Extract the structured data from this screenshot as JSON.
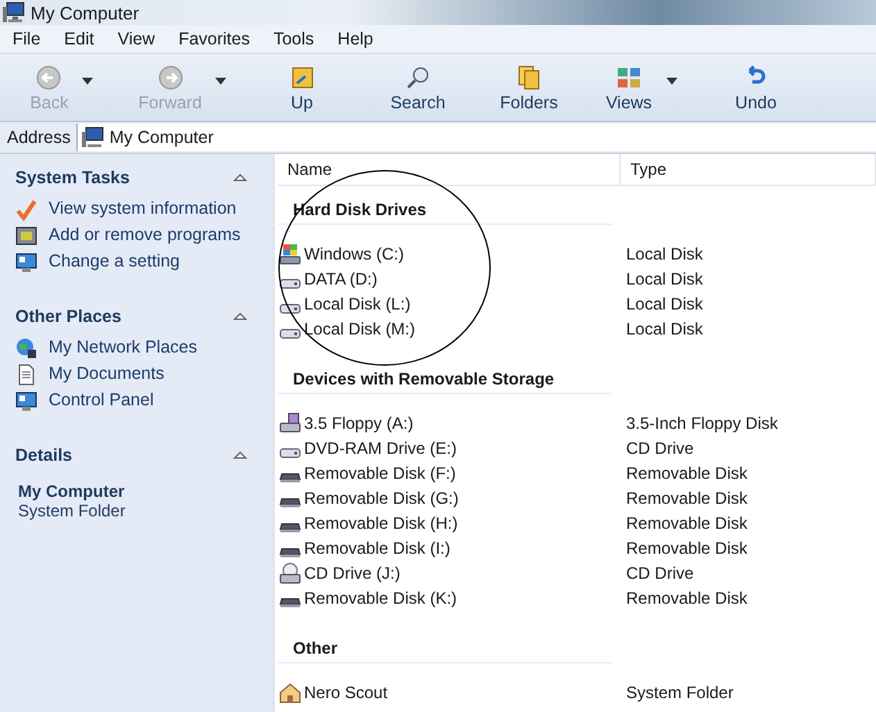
{
  "window": {
    "title": "My Computer"
  },
  "menu": [
    "File",
    "Edit",
    "View",
    "Favorites",
    "Tools",
    "Help"
  ],
  "toolbar": [
    {
      "kind": "back",
      "label": "Back",
      "disabled": true,
      "dropdown": true
    },
    {
      "kind": "forward",
      "label": "Forward",
      "disabled": true,
      "dropdown": true
    },
    {
      "kind": "up",
      "label": "Up",
      "disabled": false,
      "dropdown": false
    },
    {
      "kind": "search",
      "label": "Search",
      "disabled": false,
      "dropdown": false
    },
    {
      "kind": "folders",
      "label": "Folders",
      "disabled": false,
      "dropdown": false
    },
    {
      "kind": "views",
      "label": "Views",
      "disabled": false,
      "dropdown": true
    },
    {
      "kind": "undo",
      "label": "Undo",
      "disabled": false,
      "dropdown": false
    }
  ],
  "address": {
    "label": "Address",
    "value": "My Computer"
  },
  "sidebar": {
    "sections": [
      {
        "title": "System Tasks",
        "expanded": true,
        "items": [
          {
            "kind": "check",
            "label": "View system information"
          },
          {
            "kind": "programs",
            "label": "Add or remove programs"
          },
          {
            "kind": "setting",
            "label": "Change a setting"
          }
        ]
      },
      {
        "title": "Other Places",
        "expanded": true,
        "items": [
          {
            "kind": "network",
            "label": "My Network Places"
          },
          {
            "kind": "documents",
            "label": "My Documents"
          },
          {
            "kind": "setting",
            "label": "Control Panel"
          }
        ]
      }
    ],
    "details": {
      "title": "Details",
      "expanded": true,
      "name": "My Computer",
      "type": "System Folder"
    }
  },
  "columns": [
    "Name",
    "Type"
  ],
  "groups": [
    {
      "title": "Hard Disk Drives",
      "rows": [
        {
          "kind": "windows",
          "name": "Windows (C:)",
          "type": "Local Disk"
        },
        {
          "kind": "hdd",
          "name": "DATA (D:)",
          "type": "Local Disk"
        },
        {
          "kind": "hdd",
          "name": "Local Disk (L:)",
          "type": "Local Disk"
        },
        {
          "kind": "hdd",
          "name": "Local Disk (M:)",
          "type": "Local Disk"
        }
      ]
    },
    {
      "title": "Devices with Removable Storage",
      "rows": [
        {
          "kind": "floppy",
          "name": "3.5 Floppy (A:)",
          "type": "3.5-Inch Floppy Disk"
        },
        {
          "kind": "hdd",
          "name": "DVD-RAM Drive (E:)",
          "type": "CD Drive"
        },
        {
          "kind": "removable",
          "name": "Removable Disk (F:)",
          "type": "Removable Disk"
        },
        {
          "kind": "removable",
          "name": "Removable Disk (G:)",
          "type": "Removable Disk"
        },
        {
          "kind": "removable",
          "name": "Removable Disk (H:)",
          "type": "Removable Disk"
        },
        {
          "kind": "removable",
          "name": "Removable Disk (I:)",
          "type": "Removable Disk"
        },
        {
          "kind": "cd",
          "name": "CD Drive (J:)",
          "type": "CD Drive"
        },
        {
          "kind": "removable",
          "name": "Removable Disk (K:)",
          "type": "Removable Disk"
        }
      ]
    },
    {
      "title": "Other",
      "rows": [
        {
          "kind": "nero",
          "name": "Nero Scout",
          "type": "System Folder"
        }
      ]
    }
  ],
  "annotation": {
    "kind": "circle"
  }
}
